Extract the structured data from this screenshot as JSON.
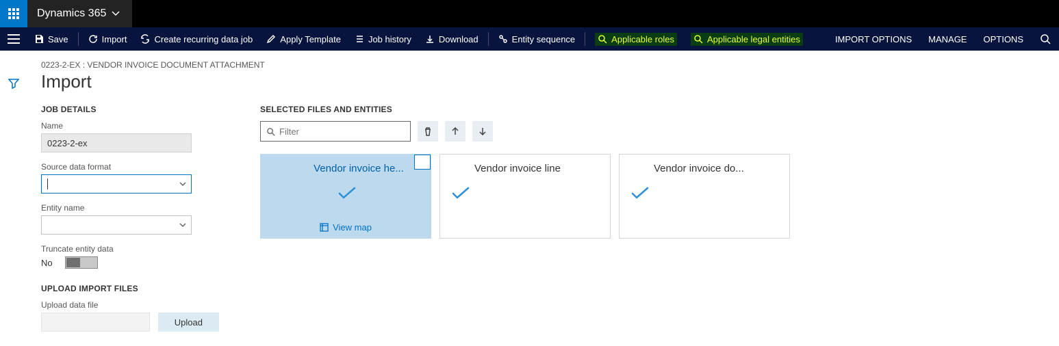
{
  "topbar": {
    "brand": "Dynamics 365"
  },
  "toolbar": {
    "save": "Save",
    "import": "Import",
    "recurring": "Create recurring data job",
    "apply_template": "Apply Template",
    "job_history": "Job history",
    "download": "Download",
    "entity_seq": "Entity sequence",
    "app_roles": "Applicable roles",
    "app_entities": "Applicable legal entities",
    "import_options": "IMPORT OPTIONS",
    "manage": "MANAGE",
    "options": "OPTIONS"
  },
  "breadcrumb": "0223-2-EX : VENDOR INVOICE DOCUMENT ATTACHMENT",
  "page_title": "Import",
  "job": {
    "section": "JOB DETAILS",
    "name_label": "Name",
    "name_value": "0223-2-ex",
    "src_label": "Source data format",
    "entity_label": "Entity name",
    "trunc_label": "Truncate entity data",
    "trunc_value": "No"
  },
  "upload": {
    "section": "UPLOAD IMPORT FILES",
    "label": "Upload data file",
    "button": "Upload"
  },
  "selected": {
    "section": "SELECTED FILES AND ENTITIES",
    "filter_placeholder": "Filter",
    "view_map": "View map",
    "cards": [
      {
        "title": "Vendor invoice he..."
      },
      {
        "title": "Vendor invoice line"
      },
      {
        "title": "Vendor invoice do..."
      }
    ]
  }
}
